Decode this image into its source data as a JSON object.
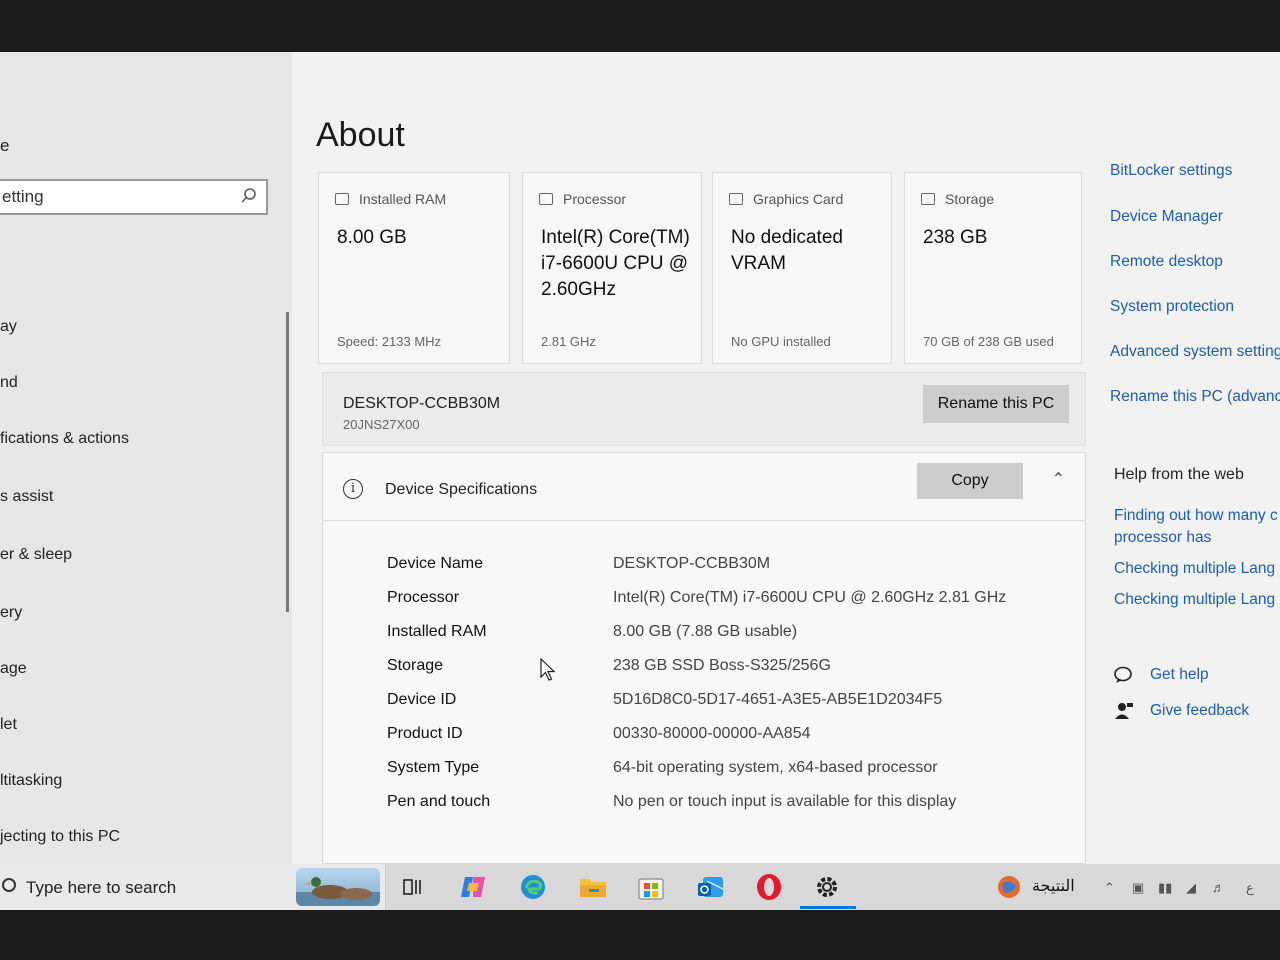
{
  "sidebar": {
    "top_label": "e",
    "search_value": "etting",
    "items": [
      {
        "label": "ay"
      },
      {
        "label": "nd"
      },
      {
        "label": "fications & actions"
      },
      {
        "label": "s assist"
      },
      {
        "label": "er & sleep"
      },
      {
        "label": "ery"
      },
      {
        "label": "age"
      },
      {
        "label": "let"
      },
      {
        "label": "ltitasking"
      },
      {
        "label": "jecting to this PC"
      }
    ]
  },
  "main": {
    "title": "About",
    "cards": [
      {
        "icon": "ram-icon",
        "head": "Installed RAM",
        "value": "8.00 GB",
        "sub": "Speed: 2133 MHz"
      },
      {
        "icon": "processor-icon",
        "head": "Processor",
        "value": "Intel(R) Core(TM) i7-6600U CPU @ 2.60GHz",
        "sub": "2.81 GHz"
      },
      {
        "icon": "graphics-card-icon",
        "head": "Graphics Card",
        "value": "No dedicated VRAM",
        "sub": "No GPU installed"
      },
      {
        "icon": "storage-icon",
        "head": "Storage",
        "value": "238 GB",
        "sub": "70 GB of 238 GB used"
      }
    ],
    "pc": {
      "name": "DESKTOP-CCBB30M",
      "model": "20JNS27X00",
      "rename_label": "Rename this PC"
    },
    "specs": {
      "title": "Device Specifications",
      "copy_label": "Copy",
      "rows": [
        {
          "label": "Device Name",
          "value": "DESKTOP-CCBB30M"
        },
        {
          "label": "Processor",
          "value": "Intel(R) Core(TM) i7-6600U CPU @ 2.60GHz   2.81 GHz"
        },
        {
          "label": "Installed RAM",
          "value": "8.00 GB (7.88 GB usable)"
        },
        {
          "label": "Storage",
          "value": "238 GB SSD Boss-S325/256G"
        },
        {
          "label": "Device ID",
          "value": "5D16D8C0-5D17-4651-A3E5-AB5E1D2034F5"
        },
        {
          "label": "Product ID",
          "value": "00330-80000-00000-AA854"
        },
        {
          "label": "System Type",
          "value": "64-bit operating system, x64-based processor"
        },
        {
          "label": "Pen and touch",
          "value": "No pen or touch input is available for this display"
        }
      ]
    }
  },
  "right_links": [
    {
      "label": "BitLocker settings"
    },
    {
      "label": "Device Manager"
    },
    {
      "label": "Remote desktop"
    },
    {
      "label": "System protection"
    },
    {
      "label": "Advanced system setting"
    },
    {
      "label": "Rename this PC (advanc"
    }
  ],
  "help": {
    "title": "Help from the web",
    "links": [
      {
        "label": "Finding out how many c"
      },
      {
        "label": "processor has"
      },
      {
        "label": "Checking multiple Lang"
      },
      {
        "label": "Checking multiple Lang"
      }
    ],
    "get_help": "Get help",
    "feedback": "Give feedback"
  },
  "taskbar": {
    "search_placeholder": "Type here to search",
    "weather_text": "النتيجة",
    "apps": [
      "task-view-icon",
      "copilot-icon",
      "edge-icon",
      "file-explorer-icon",
      "store-icon",
      "outlook-icon",
      "opera-icon",
      "settings-icon"
    ]
  },
  "colors": {
    "link": "#1a5fb4",
    "button": "#cccccc",
    "accent": "#0078d4"
  }
}
